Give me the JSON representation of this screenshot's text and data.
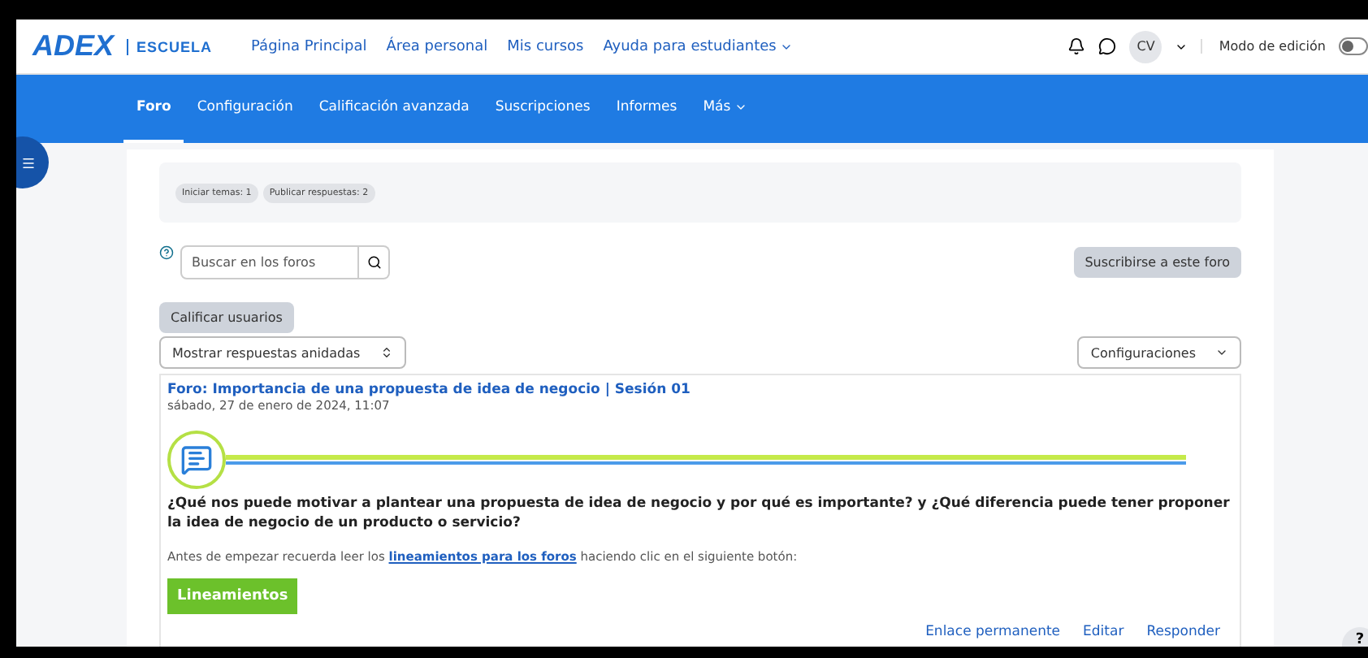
{
  "brand": {
    "logo": "ADEX",
    "sub": "ESCUELA"
  },
  "nav": [
    {
      "label": "Página Principal",
      "dropdown": false
    },
    {
      "label": "Área personal",
      "dropdown": false
    },
    {
      "label": "Mis cursos",
      "dropdown": false
    },
    {
      "label": "Ayuda para estudiantes",
      "dropdown": true
    }
  ],
  "user": {
    "initials": "CV"
  },
  "edit_mode": {
    "label": "Modo de edición",
    "on": false
  },
  "tabs": [
    {
      "label": "Foro",
      "selected": true,
      "dropdown": false
    },
    {
      "label": "Configuración",
      "selected": false,
      "dropdown": false
    },
    {
      "label": "Calificación avanzada",
      "selected": false,
      "dropdown": false
    },
    {
      "label": "Suscripciones",
      "selected": false,
      "dropdown": false
    },
    {
      "label": "Informes",
      "selected": false,
      "dropdown": false
    },
    {
      "label": "Más",
      "selected": false,
      "dropdown": true
    }
  ],
  "badges": [
    "Iniciar temas: 1",
    "Publicar respuestas: 2"
  ],
  "search": {
    "placeholder": "Buscar en los foros"
  },
  "subscribe_button": "Suscribirse a este foro",
  "grade_button": "Calificar usuarios",
  "display_select": "Mostrar respuestas anidadas",
  "settings_button": "Configuraciones",
  "post": {
    "title": "Foro: Importancia de una propuesta de idea de negocio | Sesión 01",
    "date": "sábado, 27 de enero de 2024, 11:07",
    "question": "¿Qué nos puede motivar a plantear una propuesta de idea de negocio y por qué es importante? y ¿Qué diferencia puede tener proponer la idea de negocio de un producto o servicio?",
    "intro_before": "Antes de empezar recuerda leer los",
    "intro_link": "lineamientos para los foros",
    "intro_after": "haciendo clic en el siguiente botón:",
    "button": "Lineamientos",
    "actions": [
      "Enlace permanente",
      "Editar",
      "Responder"
    ]
  },
  "help_button": "?"
}
